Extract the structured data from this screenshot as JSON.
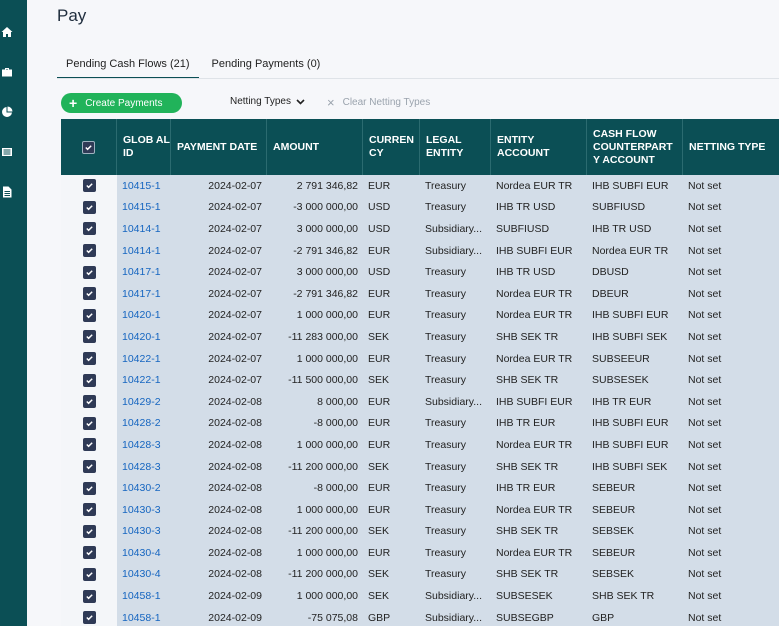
{
  "page": {
    "title": "Pay"
  },
  "sidebar": {
    "icons": [
      "home-icon",
      "briefcase-icon",
      "pie-chart-icon",
      "list-icon",
      "document-icon"
    ]
  },
  "tabs": [
    {
      "label": "Pending Cash Flows (21)",
      "active": true
    },
    {
      "label": "Pending Payments (0)",
      "active": false
    }
  ],
  "toolbar": {
    "create_label": "Create Payments",
    "netting_label": "Netting Types",
    "clear_label": "Clear Netting Types"
  },
  "colors": {
    "accent": "#0b4f55",
    "button": "#21b35a",
    "row": "#d3dde8",
    "link": "#1565c0"
  },
  "table": {
    "columns": [
      "GLOB AL ID",
      "PAYMENT DATE",
      "AMOUNT",
      "CURREN CY",
      "LEGAL ENTITY",
      "ENTITY ACCOUNT",
      "CASH FLOW COUNTERPART Y ACCOUNT",
      "NETTING TYPE"
    ],
    "rows": [
      [
        "10415-1",
        "2024-02-07",
        "2 791 346,82",
        "EUR",
        "Treasury",
        "Nordea EUR TR",
        "IHB SUBFI EUR",
        "Not set"
      ],
      [
        "10415-1",
        "2024-02-07",
        "-3 000 000,00",
        "USD",
        "Treasury",
        "IHB TR USD",
        "SUBFIUSD",
        "Not set"
      ],
      [
        "10414-1",
        "2024-02-07",
        "3 000 000,00",
        "USD",
        "Subsidiary...",
        "SUBFIUSD",
        "IHB TR USD",
        "Not set"
      ],
      [
        "10414-1",
        "2024-02-07",
        "-2 791 346,82",
        "EUR",
        "Subsidiary...",
        "IHB SUBFI EUR",
        "Nordea EUR TR",
        "Not set"
      ],
      [
        "10417-1",
        "2024-02-07",
        "3 000 000,00",
        "USD",
        "Treasury",
        "IHB TR USD",
        "DBUSD",
        "Not set"
      ],
      [
        "10417-1",
        "2024-02-07",
        "-2 791 346,82",
        "EUR",
        "Treasury",
        "Nordea EUR TR",
        "DBEUR",
        "Not set"
      ],
      [
        "10420-1",
        "2024-02-07",
        "1 000 000,00",
        "EUR",
        "Treasury",
        "Nordea EUR TR",
        "IHB SUBFI EUR",
        "Not set"
      ],
      [
        "10420-1",
        "2024-02-07",
        "-11 283 000,00",
        "SEK",
        "Treasury",
        "SHB SEK TR",
        "IHB SUBFI SEK",
        "Not set"
      ],
      [
        "10422-1",
        "2024-02-07",
        "1 000 000,00",
        "EUR",
        "Treasury",
        "Nordea EUR TR",
        "SUBSEEUR",
        "Not set"
      ],
      [
        "10422-1",
        "2024-02-07",
        "-11 500 000,00",
        "SEK",
        "Treasury",
        "SHB SEK TR",
        "SUBSESEK",
        "Not set"
      ],
      [
        "10429-2",
        "2024-02-08",
        "8 000,00",
        "EUR",
        "Subsidiary...",
        "IHB SUBFI EUR",
        "IHB TR EUR",
        "Not set"
      ],
      [
        "10428-2",
        "2024-02-08",
        "-8 000,00",
        "EUR",
        "Treasury",
        "IHB TR EUR",
        "IHB SUBFI EUR",
        "Not set"
      ],
      [
        "10428-3",
        "2024-02-08",
        "1 000 000,00",
        "EUR",
        "Treasury",
        "Nordea EUR TR",
        "IHB SUBFI EUR",
        "Not set"
      ],
      [
        "10428-3",
        "2024-02-08",
        "-11 200 000,00",
        "SEK",
        "Treasury",
        "SHB SEK TR",
        "IHB SUBFI SEK",
        "Not set"
      ],
      [
        "10430-2",
        "2024-02-08",
        "-8 000,00",
        "EUR",
        "Treasury",
        "IHB TR EUR",
        "SEBEUR",
        "Not set"
      ],
      [
        "10430-3",
        "2024-02-08",
        "1 000 000,00",
        "EUR",
        "Treasury",
        "Nordea EUR TR",
        "SEBEUR",
        "Not set"
      ],
      [
        "10430-3",
        "2024-02-08",
        "-11 200 000,00",
        "SEK",
        "Treasury",
        "SHB SEK TR",
        "SEBSEK",
        "Not set"
      ],
      [
        "10430-4",
        "2024-02-08",
        "1 000 000,00",
        "EUR",
        "Treasury",
        "Nordea EUR TR",
        "SEBEUR",
        "Not set"
      ],
      [
        "10430-4",
        "2024-02-08",
        "-11 200 000,00",
        "SEK",
        "Treasury",
        "SHB SEK TR",
        "SEBSEK",
        "Not set"
      ],
      [
        "10458-1",
        "2024-02-09",
        "1 000 000,00",
        "SEK",
        "Subsidiary...",
        "SUBSESEK",
        "SHB SEK TR",
        "Not set"
      ],
      [
        "10458-1",
        "2024-02-09",
        "-75 075,08",
        "GBP",
        "Subsidiary...",
        "SUBSEGBP",
        "GBP",
        "Not set"
      ]
    ]
  }
}
